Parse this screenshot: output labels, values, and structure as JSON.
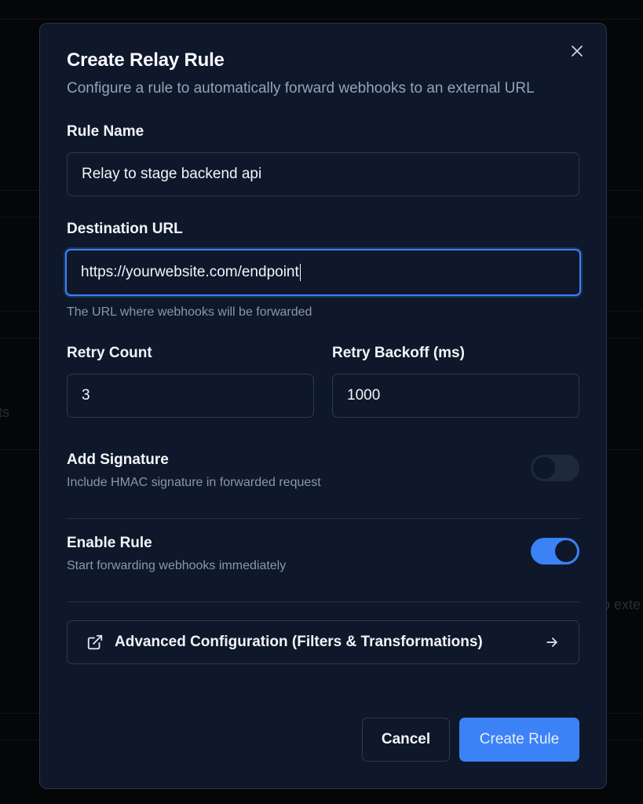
{
  "background": {
    "fragment_left": "ts",
    "fragment_right": "o exte"
  },
  "modal": {
    "title": "Create Relay Rule",
    "subtitle": "Configure a rule to automatically forward webhooks to an external URL",
    "close_icon": "close-icon"
  },
  "form": {
    "rule_name": {
      "label": "Rule Name",
      "value": "Relay to stage backend api"
    },
    "destination_url": {
      "label": "Destination URL",
      "value": "https://yourwebsite.com/endpoint",
      "help": "The URL where webhooks will be forwarded"
    },
    "retry_count": {
      "label": "Retry Count",
      "value": "3"
    },
    "retry_backoff": {
      "label": "Retry Backoff (ms)",
      "value": "1000"
    },
    "add_signature": {
      "label": "Add Signature",
      "description": "Include HMAC signature in forwarded request",
      "enabled": false
    },
    "enable_rule": {
      "label": "Enable Rule",
      "description": "Start forwarding webhooks immediately",
      "enabled": true
    },
    "advanced": {
      "label": "Advanced Configuration (Filters & Transformations)",
      "icon": "external-link-icon",
      "arrow_icon": "arrow-right-icon"
    }
  },
  "footer": {
    "cancel_label": "Cancel",
    "create_label": "Create Rule"
  },
  "colors": {
    "accent": "#3b82f6",
    "modal_bg": "#0f172a",
    "border": "#2f3a4d",
    "muted_text": "#94a3b8"
  }
}
